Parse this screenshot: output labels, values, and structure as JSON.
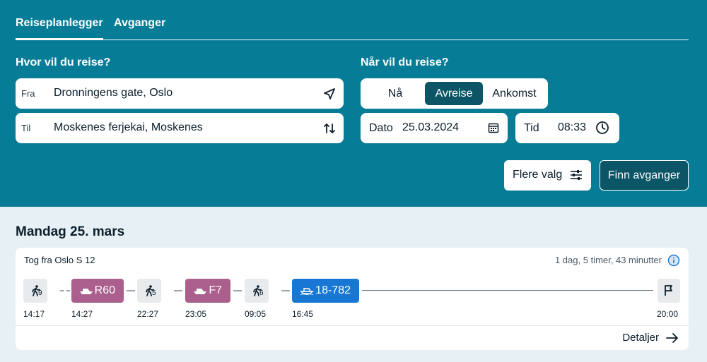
{
  "tabs": [
    {
      "label": "Reiseplanlegger",
      "active": true
    },
    {
      "label": "Avganger",
      "active": false
    }
  ],
  "where": {
    "heading": "Hvor vil du reise?",
    "from_label": "Fra",
    "from_value": "Dronningens gate, Oslo",
    "to_label": "Til",
    "to_value": "Moskenes ferjekai, Moskenes"
  },
  "when": {
    "heading": "Når vil du reise?",
    "options": [
      "Nå",
      "Avreise",
      "Ankomst"
    ],
    "selected": "Avreise",
    "date_label": "Dato",
    "date_value": "25.03.2024",
    "time_label": "Tid",
    "time_value": "08:33"
  },
  "actions": {
    "more_label": "Flere valg",
    "find_label": "Finn avganger"
  },
  "results": {
    "day_heading": "Mandag 25. mars",
    "trip": {
      "title": "Tog fra Oslo S 12",
      "duration": "1 dag, 5 timer, 43 minutter",
      "legs": [
        {
          "type": "walk",
          "minutes": "9",
          "time": "14:17"
        },
        {
          "type": "ferry",
          "code": "R60",
          "time": "14:27"
        },
        {
          "type": "walk",
          "minutes": "5",
          "time": "22:27"
        },
        {
          "type": "ferry",
          "code": "F7",
          "time": "23:05"
        },
        {
          "type": "walk",
          "minutes": "6",
          "time": "09:05"
        },
        {
          "type": "bus-ferry",
          "code": "18-782",
          "time": "16:45"
        }
      ],
      "arrival_time": "20:00",
      "details_label": "Detaljer"
    }
  },
  "colors": {
    "header_bg": "#077c97",
    "accent_dark": "#0b5566",
    "ferry": "#aa5f8c",
    "bus": "#1877d3",
    "page_bg": "#e6f0f5"
  },
  "icons": [
    "location-arrow-icon",
    "swap-icon",
    "calendar-icon",
    "clock-icon",
    "sliders-icon",
    "info-icon",
    "walk-icon",
    "ferry-icon",
    "flag-icon",
    "arrow-right-icon"
  ]
}
